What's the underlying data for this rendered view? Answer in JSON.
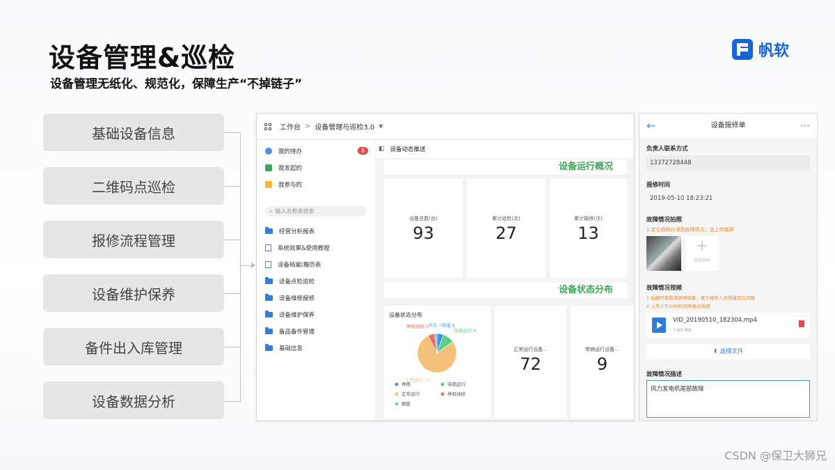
{
  "header": {
    "title": "设备管理&巡检",
    "subtitle": "设备管理无纸化、规范化，保障生产“不掉链子”",
    "logo_text": "帆软",
    "brand_color": "#1565d8"
  },
  "features": [
    "基础设备信息",
    "二维码点巡检",
    "报修流程管理",
    "设备维护保养",
    "备件出入库管理",
    "设备数据分析"
  ],
  "app": {
    "topbar": {
      "home": "工作台",
      "separator": ">",
      "current": "设备管理与巡检3.0"
    },
    "sidebar": {
      "todo": {
        "label": "我的待办",
        "badge": "6"
      },
      "initiated": "我发起的",
      "participated": "我参与的",
      "search_placeholder": "输入名称来搜索",
      "items": [
        "经营分析报表",
        "系统效果&使用教程",
        "设备档案/履历表",
        "设备点检巡检",
        "设备维修报修",
        "设备维护保养",
        "备品备件管理",
        "基础信息"
      ]
    },
    "content": {
      "tab": "设备动态推送",
      "overview_title": "设备运行概况",
      "status_title": "设备状态分布",
      "kpis": [
        {
          "label": "设备总数(台)",
          "value": "93"
        },
        {
          "label": "累计巡检(次)",
          "value": "27"
        },
        {
          "label": "累计报修(次)",
          "value": "13"
        }
      ],
      "status_cards": [
        {
          "label": "正常运行设备...",
          "value": "72"
        },
        {
          "label": "带病运行设备...",
          "value": "9"
        }
      ]
    }
  },
  "chart_data": {
    "type": "pie",
    "title": "设备状态分布",
    "slices": [
      {
        "name": "正常运行",
        "value": 72,
        "color": "#f4c07a"
      },
      {
        "name": "带病运行",
        "value": 9,
        "color": "#5ccf86"
      },
      {
        "name": "停机待修",
        "value": 5,
        "color": "#ee6b60"
      },
      {
        "name": "停用",
        "value": 5,
        "color": "#4a90e2"
      },
      {
        "name": "报废",
        "value": 2,
        "color": "#6fcbd6"
      }
    ],
    "labels": [
      "停用 5",
      "带病运行 9",
      "正常运行 72",
      "停机待修 5",
      "报废 2"
    ],
    "legend": [
      "停用",
      "带病运行",
      "正常运行",
      "停机待修",
      "报废"
    ],
    "legend_position": "bottom"
  },
  "mobile": {
    "title": "设备报修单",
    "contact_label": "负责人联系方式",
    "contact_value": "13372728448",
    "time_label": "报修时间",
    "time_value": "2019-05-10 18:23:21",
    "photo_label": "故障情况拍照",
    "photo_hint": "1.定位拍照片请把故障情况，送上传截屏",
    "choose_photo": "选择图片",
    "video_label": "故障情况视频",
    "video_hints": [
      "1.拍摄时请看清故障现象，便于维修人员快速定位问题",
      "2.上传小于20M的视频格式视频"
    ],
    "video_file": "VID_20190510_182304.mp4",
    "video_size": "7.65 MB",
    "choose_file": "选择文件",
    "desc_label": "故障情况描述",
    "desc_value": "风力发电机尾部故障"
  },
  "watermark": "CSDN @保卫大狮兄"
}
